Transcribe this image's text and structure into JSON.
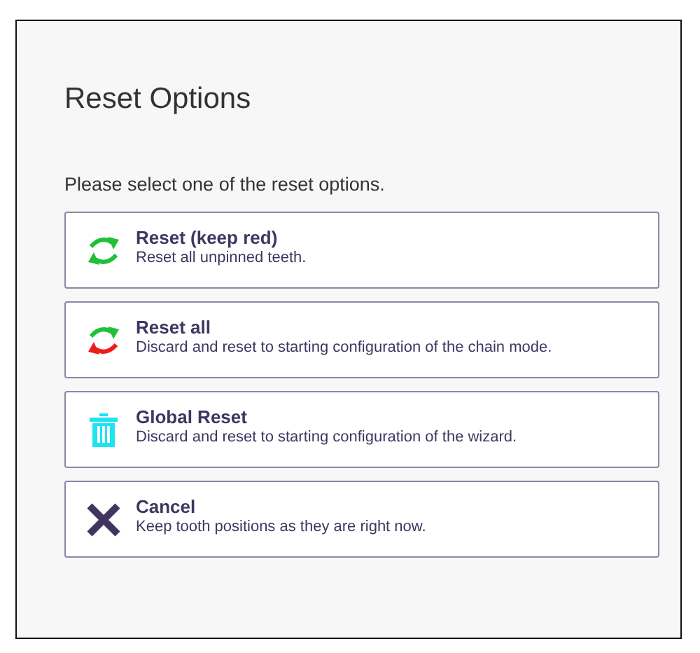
{
  "dialog": {
    "title": "Reset Options",
    "instruction": "Please select one of the reset options."
  },
  "options": [
    {
      "kind": "refresh-green",
      "title": "Reset (keep red)",
      "description": "Reset all unpinned teeth."
    },
    {
      "kind": "refresh-mixed",
      "title": "Reset all",
      "description": "Discard and reset to starting configuration of the chain mode."
    },
    {
      "kind": "trash",
      "title": "Global Reset",
      "description": "Discard and reset to starting configuration of the wizard."
    },
    {
      "kind": "cross",
      "title": "Cancel",
      "description": "Keep tooth positions as they are right now."
    }
  ]
}
